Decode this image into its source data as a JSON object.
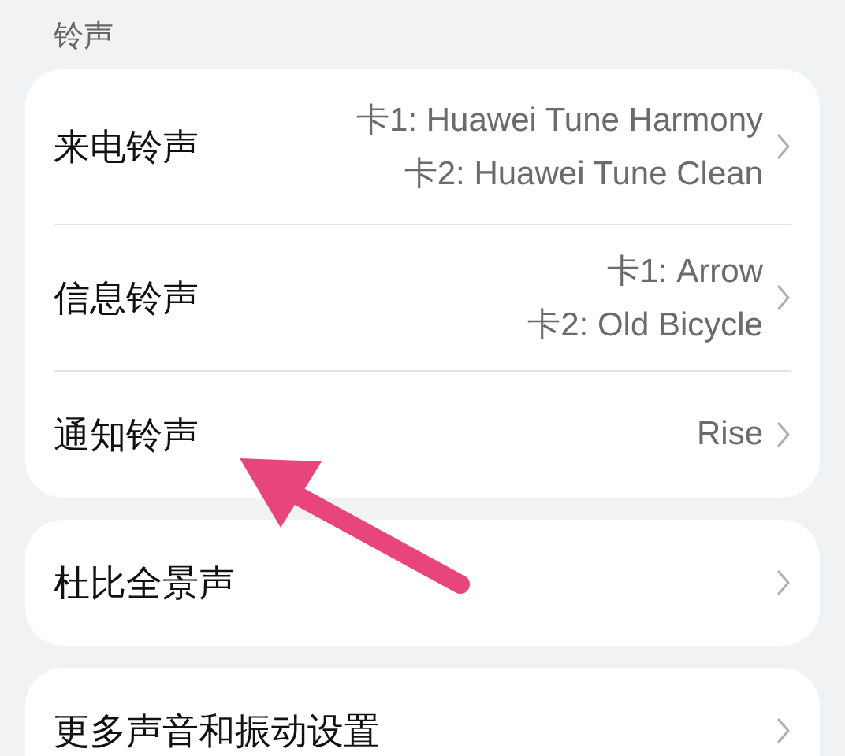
{
  "section_title": "铃声",
  "groups": [
    {
      "rows": [
        {
          "title": "来电铃声",
          "values": [
            "卡1: Huawei Tune Harmony",
            "卡2: Huawei Tune Clean"
          ]
        },
        {
          "title": "信息铃声",
          "values": [
            "卡1: Arrow",
            "卡2: Old Bicycle"
          ]
        },
        {
          "title": "通知铃声",
          "values": [
            "Rise"
          ]
        }
      ]
    },
    {
      "rows": [
        {
          "title": "杜比全景声",
          "values": []
        }
      ]
    },
    {
      "rows": [
        {
          "title": "更多声音和振动设置",
          "values": []
        }
      ]
    }
  ]
}
